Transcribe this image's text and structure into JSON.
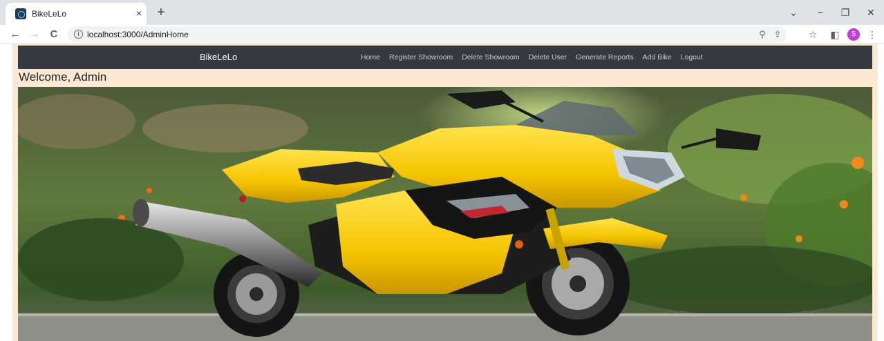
{
  "browser": {
    "tab_title": "BikeLeLo",
    "tab_close": "×",
    "new_tab": "+",
    "url": "localhost:3000/AdminHome",
    "profile_initial": "S",
    "icons": {
      "back": "←",
      "forward": "→",
      "reload": "C",
      "zoom": "⚲",
      "share": "⇪",
      "bookmark": "☆",
      "sidepanel": "◧",
      "menu": "⋮",
      "minimize": "−",
      "restore": "❐",
      "close": "✕",
      "tab_search": "⌄"
    }
  },
  "navbar": {
    "brand": "BikeLeLo",
    "links": [
      "Home",
      "Register Showroom",
      "Delete Showroom",
      "Delete User",
      "Generate Reports",
      "Add Bike",
      "Logout"
    ]
  },
  "welcome": "Welcome, Admin",
  "colors": {
    "navbar_bg": "#343a40",
    "page_bg": "#fbe9d3",
    "bike_yellow": "#f5c400"
  }
}
